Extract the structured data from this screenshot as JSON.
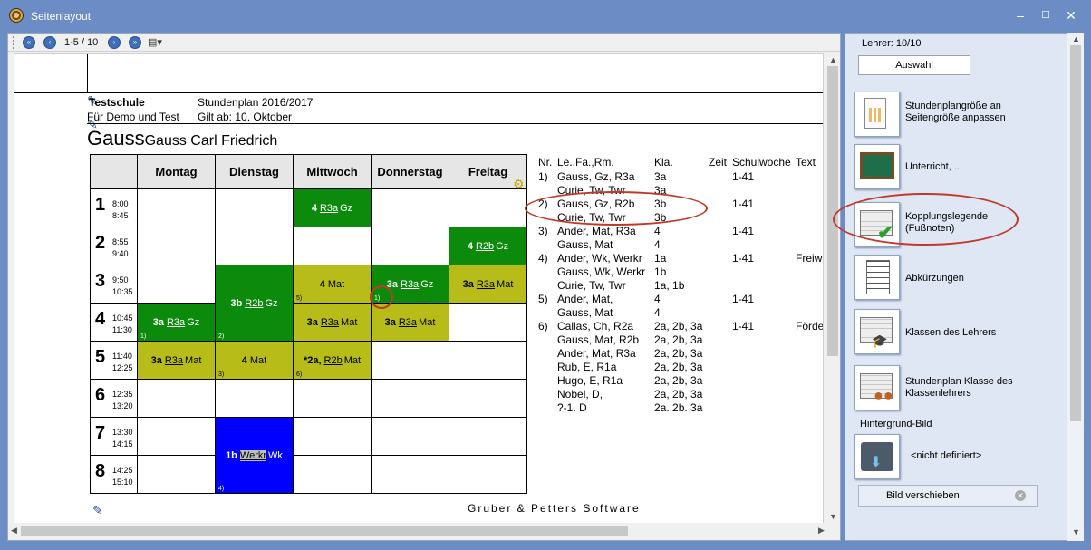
{
  "window": {
    "title": "Seitenlayout"
  },
  "toolbar": {
    "page_info": "1-5 / 10"
  },
  "header": {
    "school": "Testschule",
    "school_sub": "Für Demo und Test",
    "plan": "Stundenplan 2016/2017",
    "valid": "Gilt ab: 10. Oktober",
    "teacher_short": "Gauss",
    "teacher_full": "Gauss Carl Friedrich"
  },
  "days": [
    "Montag",
    "Dienstag",
    "Mittwoch",
    "Donnerstag",
    "Freitag"
  ],
  "periods": [
    {
      "n": "1",
      "t1": "8:00",
      "t2": "8:45"
    },
    {
      "n": "2",
      "t1": "8:55",
      "t2": "9:40"
    },
    {
      "n": "3",
      "t1": "9:50",
      "t2": "10:35"
    },
    {
      "n": "4",
      "t1": "10:45",
      "t2": "11:30"
    },
    {
      "n": "5",
      "t1": "11:40",
      "t2": "12:25"
    },
    {
      "n": "6",
      "t1": "12:35",
      "t2": "13:20"
    },
    {
      "n": "7",
      "t1": "13:30",
      "t2": "14:15"
    },
    {
      "n": "8",
      "t1": "14:25",
      "t2": "15:10"
    }
  ],
  "lessons": {
    "mi1": {
      "cls": "4",
      "room": "R3a",
      "subj": "Gz"
    },
    "fr2": {
      "cls": "4",
      "room": "R2b",
      "subj": "Gz"
    },
    "di34": {
      "cls": "3b",
      "room": "R2b",
      "subj": "Gz",
      "fn": "2)"
    },
    "mi3": {
      "cls": "4",
      "subj": "Mat",
      "fn": "5)"
    },
    "do3": {
      "cls": "3a",
      "room": "R3a",
      "subj": "Gz",
      "fn": "1)"
    },
    "fr3": {
      "cls": "3a",
      "room": "R3a",
      "subj": "Mat"
    },
    "mo4": {
      "cls": "3a",
      "room": "R3a",
      "subj": "Gz",
      "fn": "1)"
    },
    "mi4": {
      "cls": "3a",
      "room": "R3a",
      "subj": "Mat"
    },
    "do4": {
      "cls": "3a",
      "room": "R3a",
      "subj": "Mat"
    },
    "mo5": {
      "cls": "3a",
      "room": "R3a",
      "subj": "Mat"
    },
    "di5": {
      "cls": "4",
      "subj": "Mat",
      "fn": "3)"
    },
    "mi5": {
      "cls": "*2a,",
      "room": "R2b",
      "subj": "Mat",
      "fn": "6)"
    },
    "di78": {
      "cls": "1b",
      "room": "Werkr",
      "subj": "Wk",
      "fn": "4)"
    }
  },
  "legend": {
    "headers": {
      "nr": "Nr.",
      "lfr": "Le.,Fa.,Rm.",
      "kla": "Kla.",
      "zeit": "Zeit",
      "woche": "Schulwoche",
      "text": "Text"
    },
    "rows": [
      {
        "nr": "1)",
        "lfr": "Gauss, Gz, R3a",
        "kla": "3a",
        "woche": "1-41",
        "text": ""
      },
      {
        "nr": "",
        "lfr": "Curie, Tw, Twr",
        "kla": "3a",
        "woche": "",
        "text": ""
      },
      {
        "nr": "2)",
        "lfr": "Gauss, Gz, R2b",
        "kla": "3b",
        "woche": "1-41",
        "text": ""
      },
      {
        "nr": "",
        "lfr": "Curie, Tw, Twr",
        "kla": "3b",
        "woche": "",
        "text": ""
      },
      {
        "nr": "3)",
        "lfr": "Ander, Mat, R3a",
        "kla": "4",
        "woche": "1-41",
        "text": ""
      },
      {
        "nr": "",
        "lfr": "Gauss, Mat",
        "kla": "4",
        "woche": "",
        "text": ""
      },
      {
        "nr": "4)",
        "lfr": "Ander, Wk, Werkr",
        "kla": "1a",
        "woche": "1-41",
        "text": "Freiwi"
      },
      {
        "nr": "",
        "lfr": "Gauss, Wk, Werkr",
        "kla": "1b",
        "woche": "",
        "text": ""
      },
      {
        "nr": "",
        "lfr": "Curie, Tw, Twr",
        "kla": "1a, 1b",
        "woche": "",
        "text": ""
      },
      {
        "nr": "5)",
        "lfr": "Ander, Mat,",
        "kla": "4",
        "woche": "1-41",
        "text": ""
      },
      {
        "nr": "",
        "lfr": "Gauss, Mat",
        "kla": "4",
        "woche": "",
        "text": ""
      },
      {
        "nr": "6)",
        "lfr": "Callas, Ch, R2a",
        "kla": "2a, 2b, 3a",
        "woche": "1-41",
        "text": "Förde"
      },
      {
        "nr": "",
        "lfr": "Gauss, Mat, R2b",
        "kla": "2a, 2b, 3a",
        "woche": "",
        "text": ""
      },
      {
        "nr": "",
        "lfr": "Ander, Mat, R3a",
        "kla": "2a, 2b, 3a",
        "woche": "",
        "text": ""
      },
      {
        "nr": "",
        "lfr": "Rub, E, R1a",
        "kla": "2a, 2b, 3a",
        "woche": "",
        "text": ""
      },
      {
        "nr": "",
        "lfr": "Hugo, E, R1a",
        "kla": "2a, 2b, 3a",
        "woche": "",
        "text": ""
      },
      {
        "nr": "",
        "lfr": "Nobel, D,",
        "kla": "2a, 2b, 3a",
        "woche": "",
        "text": ""
      },
      {
        "nr": "",
        "lfr": "?-1. D",
        "kla": "2a. 2b. 3a",
        "woche": "",
        "text": ""
      }
    ]
  },
  "footer": "Gruber & Petters Software",
  "right_panel": {
    "lehrer": "Lehrer: 10/10",
    "auswahl": "Auswahl",
    "items": [
      {
        "label1": "Stundenplangröße an",
        "label2": "Seitengröße anpassen"
      },
      {
        "label1": "Unterricht, ...",
        "label2": ""
      },
      {
        "label1": "Kopplungslegende",
        "label2": "(Fußnoten)"
      },
      {
        "label1": "Abkürzungen",
        "label2": ""
      },
      {
        "label1": "Klassen des Lehrers",
        "label2": ""
      },
      {
        "label1": "Stundenplan Klasse des",
        "label2": "Klassenlehrers"
      }
    ],
    "hintergrund": "Hintergrund-Bild",
    "nicht_definiert": "<nicht definiert>",
    "bild_verschieben": "Bild verschieben"
  },
  "colors": {
    "green": "#0b8a0b",
    "olive": "#b8bc18",
    "blue": "#0000ff",
    "annotation": "#c0392b"
  }
}
